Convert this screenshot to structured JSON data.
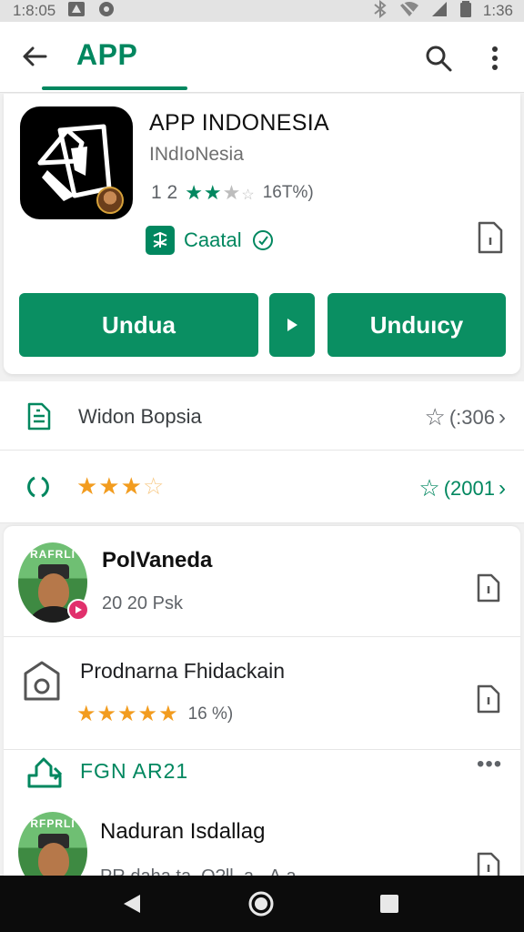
{
  "status_bar": {
    "time_left": "1:8:05",
    "time_right": "1:36"
  },
  "app_bar": {
    "title": "APP"
  },
  "app": {
    "name": "APP INDONESIA",
    "developer": "INdIoNesia",
    "rating_value": "1 2",
    "rating_stars_filled": 2,
    "rating_percent": "16T%)",
    "category": "Caatal",
    "install_label": "Undua",
    "download_label": "Unduıcy"
  },
  "info": {
    "row1_label": "Widon Bopsia",
    "row1_trailing": "(:306",
    "row2_stars_filled": 3,
    "row2_trailing": "(2001"
  },
  "reviews": [
    {
      "name": "PolVaneda",
      "meta": "20 20 Psk",
      "avatar_ribbon": "RAFRLI"
    },
    {
      "title": "Prodnarna Fhidackain",
      "stars_filled": 5,
      "percent": "16 %)"
    },
    {
      "code": "FGN AR21"
    },
    {
      "name": "Naduran Isdallag",
      "sub": "PR.daha.ta. O?ll..a. .A.a",
      "avatar_ribbon": "RFPRLI"
    }
  ],
  "colors": {
    "accent": "#01875f",
    "button": "#0a8f62",
    "star_orange": "#f29c1f",
    "nav_bg": "#0c0c0c"
  }
}
